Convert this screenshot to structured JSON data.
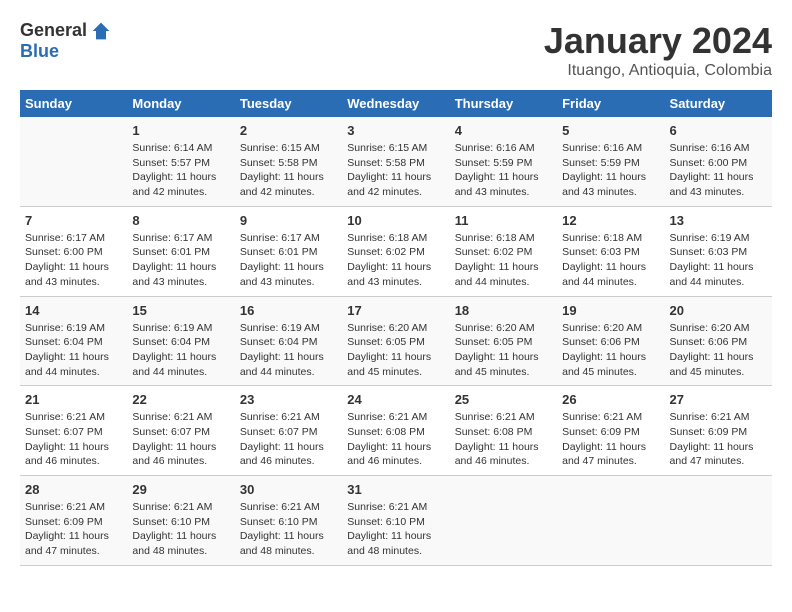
{
  "logo": {
    "general": "General",
    "blue": "Blue"
  },
  "title": "January 2024",
  "subtitle": "Ituango, Antioquia, Colombia",
  "days_header": [
    "Sunday",
    "Monday",
    "Tuesday",
    "Wednesday",
    "Thursday",
    "Friday",
    "Saturday"
  ],
  "weeks": [
    [
      {
        "day": "",
        "sunrise": "",
        "sunset": "",
        "daylight": ""
      },
      {
        "day": "1",
        "sunrise": "Sunrise: 6:14 AM",
        "sunset": "Sunset: 5:57 PM",
        "daylight": "Daylight: 11 hours and 42 minutes."
      },
      {
        "day": "2",
        "sunrise": "Sunrise: 6:15 AM",
        "sunset": "Sunset: 5:58 PM",
        "daylight": "Daylight: 11 hours and 42 minutes."
      },
      {
        "day": "3",
        "sunrise": "Sunrise: 6:15 AM",
        "sunset": "Sunset: 5:58 PM",
        "daylight": "Daylight: 11 hours and 42 minutes."
      },
      {
        "day": "4",
        "sunrise": "Sunrise: 6:16 AM",
        "sunset": "Sunset: 5:59 PM",
        "daylight": "Daylight: 11 hours and 43 minutes."
      },
      {
        "day": "5",
        "sunrise": "Sunrise: 6:16 AM",
        "sunset": "Sunset: 5:59 PM",
        "daylight": "Daylight: 11 hours and 43 minutes."
      },
      {
        "day": "6",
        "sunrise": "Sunrise: 6:16 AM",
        "sunset": "Sunset: 6:00 PM",
        "daylight": "Daylight: 11 hours and 43 minutes."
      }
    ],
    [
      {
        "day": "7",
        "sunrise": "Sunrise: 6:17 AM",
        "sunset": "Sunset: 6:00 PM",
        "daylight": "Daylight: 11 hours and 43 minutes."
      },
      {
        "day": "8",
        "sunrise": "Sunrise: 6:17 AM",
        "sunset": "Sunset: 6:01 PM",
        "daylight": "Daylight: 11 hours and 43 minutes."
      },
      {
        "day": "9",
        "sunrise": "Sunrise: 6:17 AM",
        "sunset": "Sunset: 6:01 PM",
        "daylight": "Daylight: 11 hours and 43 minutes."
      },
      {
        "day": "10",
        "sunrise": "Sunrise: 6:18 AM",
        "sunset": "Sunset: 6:02 PM",
        "daylight": "Daylight: 11 hours and 43 minutes."
      },
      {
        "day": "11",
        "sunrise": "Sunrise: 6:18 AM",
        "sunset": "Sunset: 6:02 PM",
        "daylight": "Daylight: 11 hours and 44 minutes."
      },
      {
        "day": "12",
        "sunrise": "Sunrise: 6:18 AM",
        "sunset": "Sunset: 6:03 PM",
        "daylight": "Daylight: 11 hours and 44 minutes."
      },
      {
        "day": "13",
        "sunrise": "Sunrise: 6:19 AM",
        "sunset": "Sunset: 6:03 PM",
        "daylight": "Daylight: 11 hours and 44 minutes."
      }
    ],
    [
      {
        "day": "14",
        "sunrise": "Sunrise: 6:19 AM",
        "sunset": "Sunset: 6:04 PM",
        "daylight": "Daylight: 11 hours and 44 minutes."
      },
      {
        "day": "15",
        "sunrise": "Sunrise: 6:19 AM",
        "sunset": "Sunset: 6:04 PM",
        "daylight": "Daylight: 11 hours and 44 minutes."
      },
      {
        "day": "16",
        "sunrise": "Sunrise: 6:19 AM",
        "sunset": "Sunset: 6:04 PM",
        "daylight": "Daylight: 11 hours and 44 minutes."
      },
      {
        "day": "17",
        "sunrise": "Sunrise: 6:20 AM",
        "sunset": "Sunset: 6:05 PM",
        "daylight": "Daylight: 11 hours and 45 minutes."
      },
      {
        "day": "18",
        "sunrise": "Sunrise: 6:20 AM",
        "sunset": "Sunset: 6:05 PM",
        "daylight": "Daylight: 11 hours and 45 minutes."
      },
      {
        "day": "19",
        "sunrise": "Sunrise: 6:20 AM",
        "sunset": "Sunset: 6:06 PM",
        "daylight": "Daylight: 11 hours and 45 minutes."
      },
      {
        "day": "20",
        "sunrise": "Sunrise: 6:20 AM",
        "sunset": "Sunset: 6:06 PM",
        "daylight": "Daylight: 11 hours and 45 minutes."
      }
    ],
    [
      {
        "day": "21",
        "sunrise": "Sunrise: 6:21 AM",
        "sunset": "Sunset: 6:07 PM",
        "daylight": "Daylight: 11 hours and 46 minutes."
      },
      {
        "day": "22",
        "sunrise": "Sunrise: 6:21 AM",
        "sunset": "Sunset: 6:07 PM",
        "daylight": "Daylight: 11 hours and 46 minutes."
      },
      {
        "day": "23",
        "sunrise": "Sunrise: 6:21 AM",
        "sunset": "Sunset: 6:07 PM",
        "daylight": "Daylight: 11 hours and 46 minutes."
      },
      {
        "day": "24",
        "sunrise": "Sunrise: 6:21 AM",
        "sunset": "Sunset: 6:08 PM",
        "daylight": "Daylight: 11 hours and 46 minutes."
      },
      {
        "day": "25",
        "sunrise": "Sunrise: 6:21 AM",
        "sunset": "Sunset: 6:08 PM",
        "daylight": "Daylight: 11 hours and 46 minutes."
      },
      {
        "day": "26",
        "sunrise": "Sunrise: 6:21 AM",
        "sunset": "Sunset: 6:09 PM",
        "daylight": "Daylight: 11 hours and 47 minutes."
      },
      {
        "day": "27",
        "sunrise": "Sunrise: 6:21 AM",
        "sunset": "Sunset: 6:09 PM",
        "daylight": "Daylight: 11 hours and 47 minutes."
      }
    ],
    [
      {
        "day": "28",
        "sunrise": "Sunrise: 6:21 AM",
        "sunset": "Sunset: 6:09 PM",
        "daylight": "Daylight: 11 hours and 47 minutes."
      },
      {
        "day": "29",
        "sunrise": "Sunrise: 6:21 AM",
        "sunset": "Sunset: 6:10 PM",
        "daylight": "Daylight: 11 hours and 48 minutes."
      },
      {
        "day": "30",
        "sunrise": "Sunrise: 6:21 AM",
        "sunset": "Sunset: 6:10 PM",
        "daylight": "Daylight: 11 hours and 48 minutes."
      },
      {
        "day": "31",
        "sunrise": "Sunrise: 6:21 AM",
        "sunset": "Sunset: 6:10 PM",
        "daylight": "Daylight: 11 hours and 48 minutes."
      },
      {
        "day": "",
        "sunrise": "",
        "sunset": "",
        "daylight": ""
      },
      {
        "day": "",
        "sunrise": "",
        "sunset": "",
        "daylight": ""
      },
      {
        "day": "",
        "sunrise": "",
        "sunset": "",
        "daylight": ""
      }
    ]
  ]
}
